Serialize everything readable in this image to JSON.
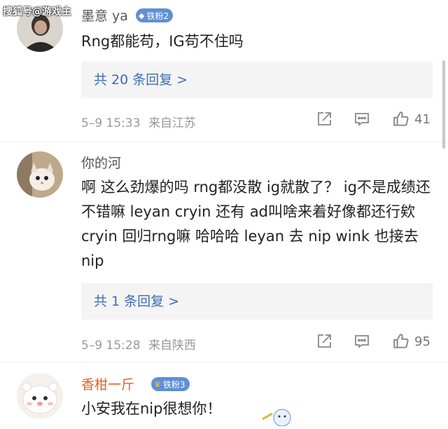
{
  "watermark": "搜狐号@游戏主",
  "comments": [
    {
      "username": "墨意 ya",
      "badge": "铁粉2",
      "text": "Rng都能苟，IG苟不住吗",
      "replies": "共 20 条回复 >",
      "time": "5–9 15:33",
      "location": "来自江苏",
      "likes": "41"
    },
    {
      "username": "你的河",
      "text": "啊 这么劲爆的吗 rng都没散 ig就散了？ ig不是成绩还不错嘛 leyan cryin 还有 ad叫啥来着好像都还行欸 cryin 回归rng嘛 哈哈哈 leyan 去 nip wink 也接去 nip",
      "replies": "共 1 条回复 >",
      "time": "5–9 15:28",
      "location": "来自陕西",
      "likes": "95"
    },
    {
      "username": "香柑一斤",
      "badge": "铁粉3",
      "text": "小安我在nip很想你！"
    }
  ],
  "colors": {
    "link_blue": "#3d6eb4",
    "badge_blue": "#5f8fd6",
    "username_orange": "#e5611a"
  },
  "icons": [
    "share-icon",
    "comment-icon",
    "like-icon"
  ]
}
